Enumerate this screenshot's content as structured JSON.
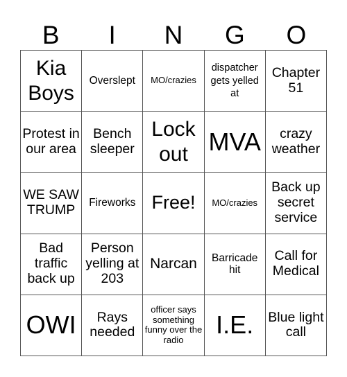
{
  "header": {
    "letters": [
      "B",
      "I",
      "N",
      "G",
      "O"
    ]
  },
  "cells": [
    "Kia Boys",
    "Overslept",
    "MO/crazies",
    "dispatcher gets yelled at",
    "Chapter 51",
    "Protest in our area",
    "Bench sleeper",
    "Lock out",
    "MVA",
    "crazy weather",
    "WE SAW TRUMP",
    "Fireworks",
    "Free!",
    "MO/crazies",
    "Back up secret service",
    "Bad traffic back up",
    "Person yelling at 203",
    "Narcan",
    "Barricade hit",
    "Call for Medical",
    "OWI",
    "Rays needed",
    "officer says something funny over the radio",
    "I.E.",
    "Blue light call"
  ]
}
